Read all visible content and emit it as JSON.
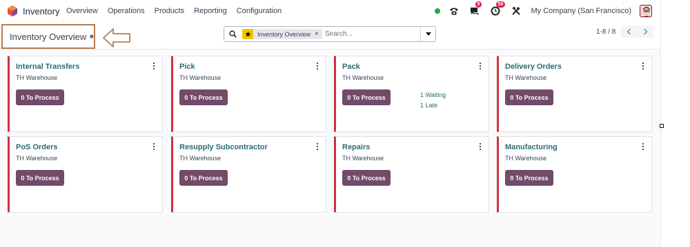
{
  "navbar": {
    "app_name": "Inventory",
    "menu": [
      "Overview",
      "Operations",
      "Products",
      "Reporting",
      "Configuration"
    ],
    "messages_badge": "9",
    "activities_badge": "59",
    "company": "My Company (San Francisco)"
  },
  "control_panel": {
    "title": "Inventory Overview",
    "search": {
      "facet_label": "Inventory Overview",
      "facet_close": "×",
      "placeholder": "Search..."
    },
    "pager": "1-8 / 8"
  },
  "cards": [
    {
      "title": "Internal Transfers",
      "warehouse": "TH Warehouse",
      "button": "0 To Process"
    },
    {
      "title": "Pick",
      "warehouse": "TH Warehouse",
      "button": "0 To Process"
    },
    {
      "title": "Pack",
      "warehouse": "TH Warehouse",
      "button": "0 To Process",
      "waiting": "1 Waiting",
      "late": "1 Late"
    },
    {
      "title": "Delivery Orders",
      "warehouse": "TH Warehouse",
      "button": "0 To Process"
    },
    {
      "title": "PoS Orders",
      "warehouse": "TH Warehouse",
      "button": "0 To Process"
    },
    {
      "title": "Resupply Subcontractor",
      "warehouse": "TH Warehouse",
      "button": "0 To Process"
    },
    {
      "title": "Repairs",
      "warehouse": "TH Warehouse",
      "button": "0 To Process"
    },
    {
      "title": "Manufacturing",
      "warehouse": "TH Warehouse",
      "button": "0 To Process"
    }
  ],
  "colors": {
    "accent": "#714b67",
    "card_border": "#d1303d",
    "link": "#2a6b73",
    "annotation": "#b77b4d",
    "favorite": "#f5c400",
    "badge": "#e11d48",
    "presence": "#28a745"
  },
  "icons": [
    "app-logo-icon",
    "phone-icon",
    "chat-icon",
    "clock-icon",
    "tools-icon",
    "gear-icon",
    "search-icon",
    "star-icon",
    "caret-down-icon",
    "chevron-left-icon",
    "chevron-right-icon",
    "kebab-menu-icon"
  ]
}
